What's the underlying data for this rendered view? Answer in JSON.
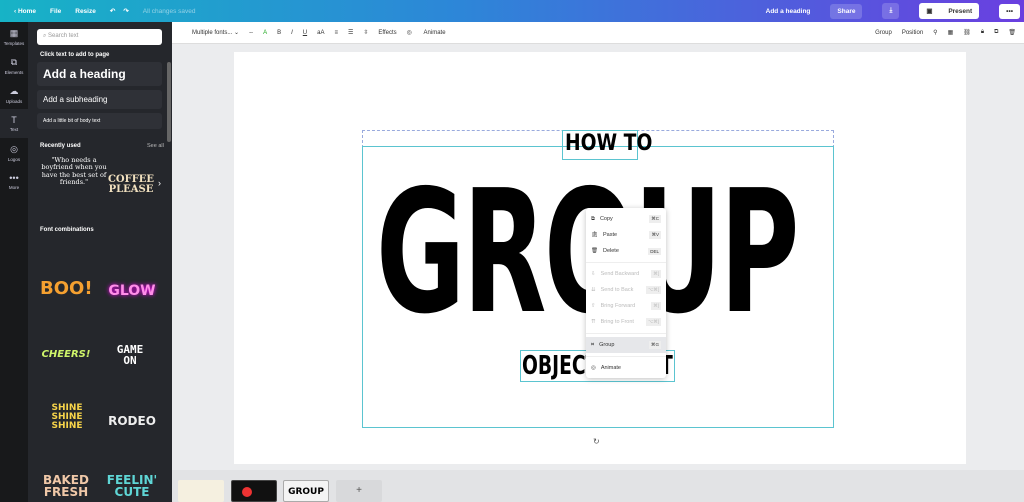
{
  "topbar": {
    "home": "Home",
    "file": "File",
    "resize": "Resize",
    "status": "All changes saved",
    "design_title": "Add a heading",
    "share": "Share",
    "present": "Present",
    "more": "•••"
  },
  "rail": [
    {
      "label": "Templates",
      "icon": "▦"
    },
    {
      "label": "Elements",
      "icon": "⧉"
    },
    {
      "label": "Uploads",
      "icon": "☁"
    },
    {
      "label": "Text",
      "icon": "T"
    },
    {
      "label": "Logos",
      "icon": "◎"
    },
    {
      "label": "More",
      "icon": "•••"
    }
  ],
  "panel": {
    "search_placeholder": "Search text",
    "click_text": "Click text to add to page",
    "heading": "Add a heading",
    "subheading": "Add a subheading",
    "body": "Add a little bit of body text",
    "recently_used": "Recently used",
    "see_all": "See all",
    "recent": [
      "\"Who needs a boyfriend when you have the best set of friends.\"",
      "COFFEE PLEASE"
    ],
    "font_combinations": "Font combinations",
    "combos": [
      "BOO!",
      "GLOW",
      "CHEERS!",
      "GAME ON",
      "SHINE SHINE SHINE",
      "RODEO",
      "BAKED FRESH",
      "FEELIN' CUTE"
    ]
  },
  "toolbar": {
    "font": "Multiple fonts...",
    "size": "--",
    "effects": "Effects",
    "animate": "Animate",
    "group": "Group",
    "position": "Position"
  },
  "canvas": {
    "line1": "HOW TO",
    "line2": "GROUP",
    "line3_left": "OBJECT",
    "line3_right": "T"
  },
  "context_menu": [
    {
      "label": "Copy",
      "key": "⌘C",
      "enabled": true
    },
    {
      "label": "Paste",
      "key": "⌘V",
      "enabled": true
    },
    {
      "label": "Delete",
      "key": "DEL",
      "enabled": true
    },
    {
      "label": "Send Backward",
      "key": "⌘[",
      "enabled": false
    },
    {
      "label": "Send to Back",
      "key": "⌥⌘[",
      "enabled": false
    },
    {
      "label": "Bring Forward",
      "key": "⌘]",
      "enabled": false
    },
    {
      "label": "Bring to Front",
      "key": "⌥⌘]",
      "enabled": false
    },
    {
      "label": "Group",
      "key": "⌘G",
      "enabled": true
    },
    {
      "label": "Animate",
      "key": "",
      "enabled": true
    }
  ],
  "pages": {
    "thumb3": "GROUP",
    "add": "+"
  }
}
